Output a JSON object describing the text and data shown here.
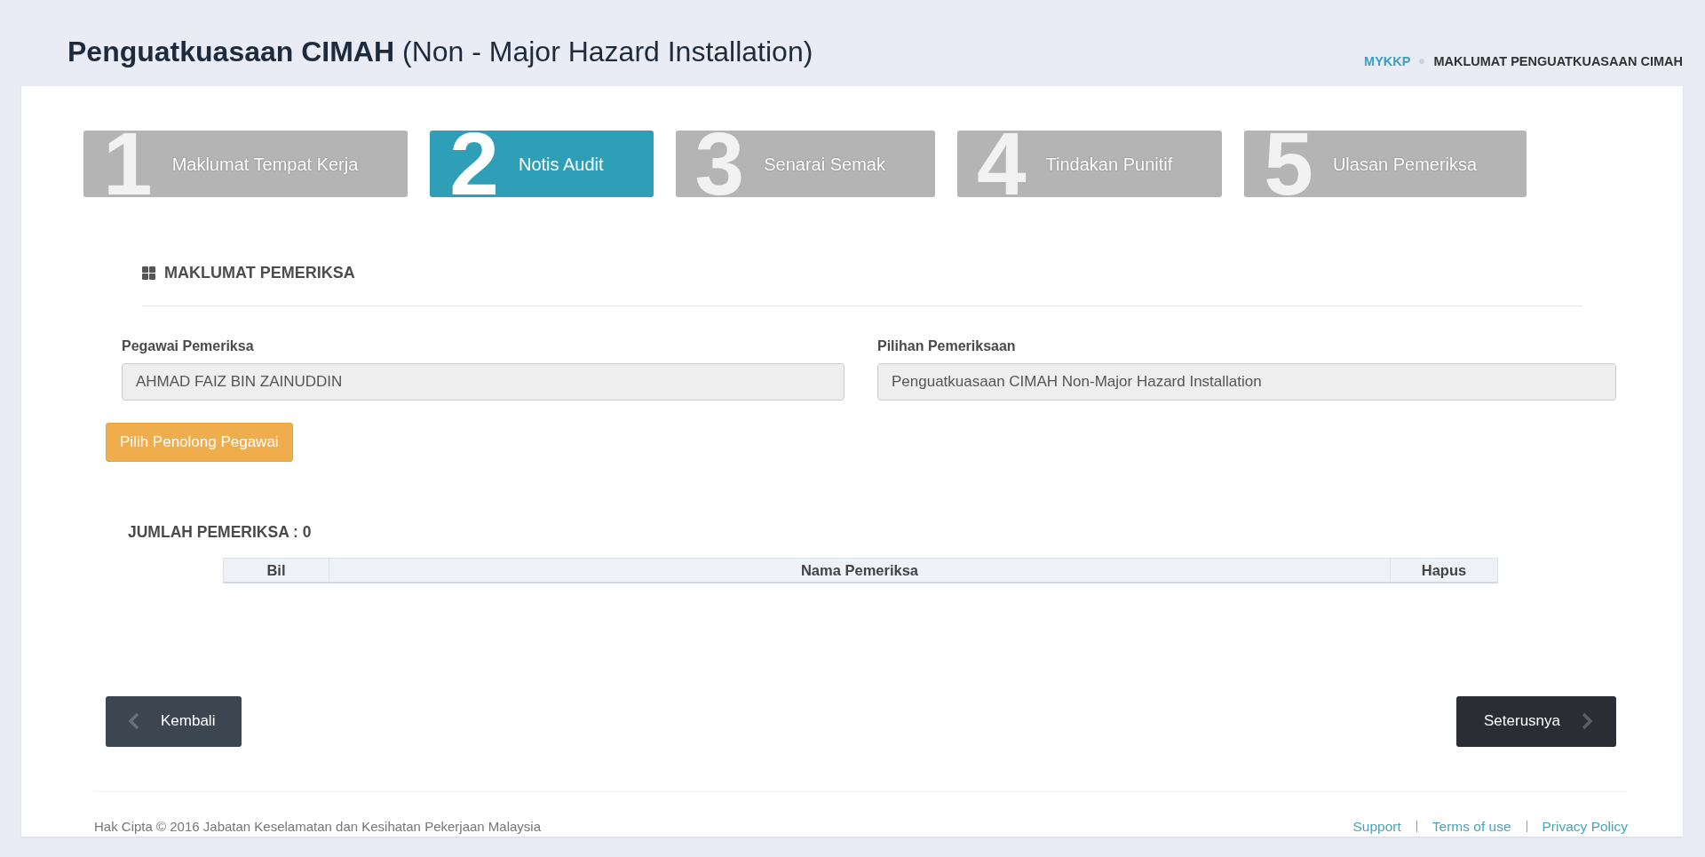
{
  "page_header": {
    "title": "**Penguatkuasaan CIMAH** (Non - Major Hazard Installation)",
    "breadcrumb": [
      {
        "label": "MYKKP",
        "kind": "link"
      },
      {
        "label": "MAKLUMAT PENGUATKUASAAN CIMAH",
        "kind": "current"
      }
    ]
  },
  "steps": [
    {
      "number": "1",
      "label": "Maklumat Tempat Kerja",
      "selected": false
    },
    {
      "number": "2",
      "label": "Notis Audit",
      "selected": true
    },
    {
      "number": "3",
      "label": "Senarai Semak",
      "selected": false
    },
    {
      "number": "4",
      "label": "Tindakan Punitif",
      "selected": false
    },
    {
      "number": "5",
      "label": "Ulasan Pemeriksa",
      "selected": false
    }
  ],
  "section": {
    "title": "MAKLUMAT PEMERIKSA"
  },
  "fields": [
    {
      "label": "Pegawai Pemeriksa",
      "value": "AHMAD FAIZ BIN ZAINUDDIN"
    },
    {
      "label": "Pilihan Pemeriksaan",
      "value": "Penguatkuasaan CIMAH Non-Major Hazard Installation"
    }
  ],
  "add_button": {
    "label": "Pilih Penolong Pegawai"
  },
  "total": "JUMLAH PEMERIKSA : 0",
  "table": {
    "columns": [
      "Bil",
      "Nama Pemeriksa",
      "Hapus"
    ]
  },
  "nav_buttons": [
    {
      "label": "Kembali",
      "kind": "back"
    },
    {
      "label": "Seterusnya",
      "kind": "next"
    }
  ],
  "footer": {
    "copyright": "Hak Cipta © 2016 Jabatan Keselamatan dan Kesihatan Pekerjaan Malaysia",
    "links": [
      "Support",
      "Terms of use",
      "Privacy Policy"
    ]
  }
}
